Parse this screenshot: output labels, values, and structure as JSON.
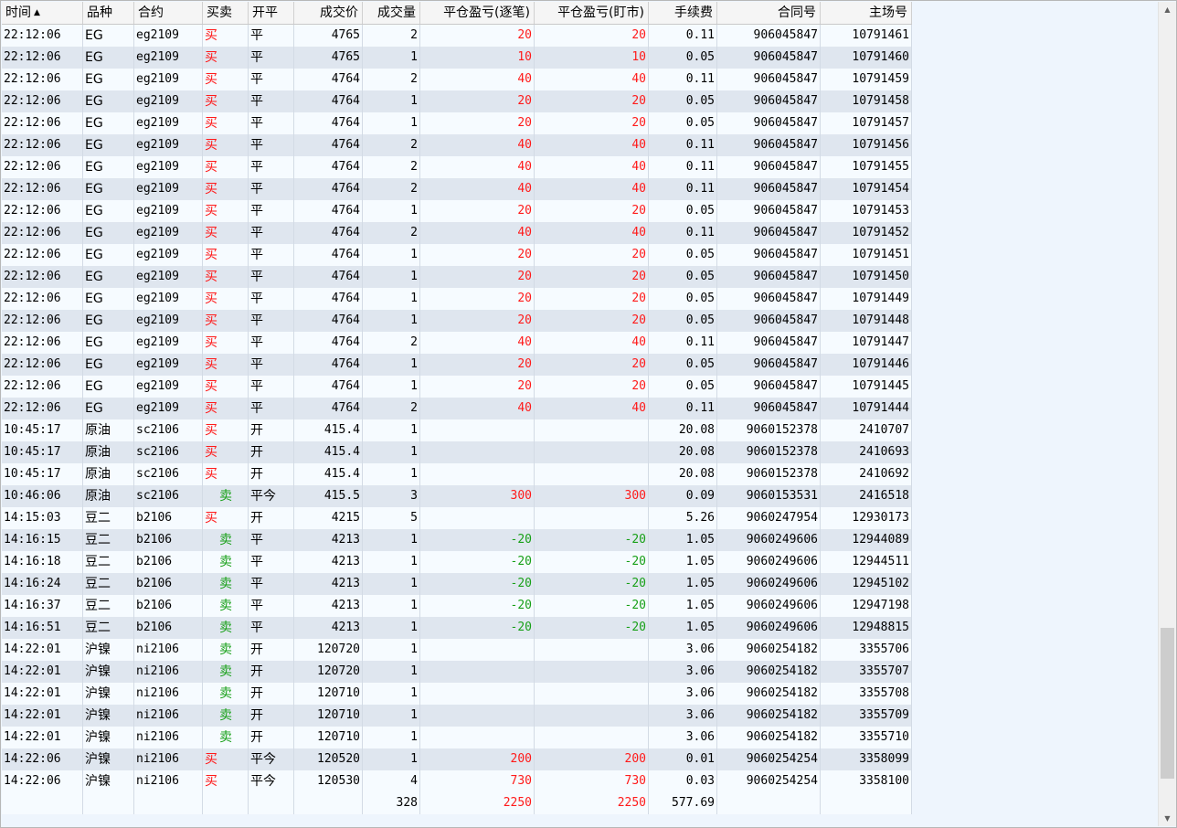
{
  "columns": [
    {
      "label": "时间",
      "w": 89,
      "align": "l"
    },
    {
      "label": "品种",
      "w": 56,
      "align": "l"
    },
    {
      "label": "合约",
      "w": 75,
      "align": "l"
    },
    {
      "label": "买卖",
      "w": 50,
      "align": "l"
    },
    {
      "label": "开平",
      "w": 50,
      "align": "l"
    },
    {
      "label": "成交价",
      "w": 75,
      "align": "r"
    },
    {
      "label": "成交量",
      "w": 63,
      "align": "r"
    },
    {
      "label": "平仓盈亏(逐笔)",
      "w": 125,
      "align": "r"
    },
    {
      "label": "平仓盈亏(盯市)",
      "w": 125,
      "align": "r"
    },
    {
      "label": "手续费",
      "w": 75,
      "align": "r"
    },
    {
      "label": "合同号",
      "w": 113,
      "align": "r"
    },
    {
      "label": "主场号",
      "w": 100,
      "align": "r"
    }
  ],
  "sort_indicator": "▲",
  "colors": {
    "buy": "#ff1a1a",
    "sell": "#18a018",
    "row_alt": "#dfe6ef"
  },
  "icons": {
    "scroll_up": "▲",
    "scroll_down": "▼"
  },
  "rows": [
    [
      "22:12:06",
      "EG",
      "eg2109",
      "买",
      "平",
      "4765",
      "2",
      "20",
      "20",
      "0.11",
      "906045847",
      "10791461"
    ],
    [
      "22:12:06",
      "EG",
      "eg2109",
      "买",
      "平",
      "4765",
      "1",
      "10",
      "10",
      "0.05",
      "906045847",
      "10791460"
    ],
    [
      "22:12:06",
      "EG",
      "eg2109",
      "买",
      "平",
      "4764",
      "2",
      "40",
      "40",
      "0.11",
      "906045847",
      "10791459"
    ],
    [
      "22:12:06",
      "EG",
      "eg2109",
      "买",
      "平",
      "4764",
      "1",
      "20",
      "20",
      "0.05",
      "906045847",
      "10791458"
    ],
    [
      "22:12:06",
      "EG",
      "eg2109",
      "买",
      "平",
      "4764",
      "1",
      "20",
      "20",
      "0.05",
      "906045847",
      "10791457"
    ],
    [
      "22:12:06",
      "EG",
      "eg2109",
      "买",
      "平",
      "4764",
      "2",
      "40",
      "40",
      "0.11",
      "906045847",
      "10791456"
    ],
    [
      "22:12:06",
      "EG",
      "eg2109",
      "买",
      "平",
      "4764",
      "2",
      "40",
      "40",
      "0.11",
      "906045847",
      "10791455"
    ],
    [
      "22:12:06",
      "EG",
      "eg2109",
      "买",
      "平",
      "4764",
      "2",
      "40",
      "40",
      "0.11",
      "906045847",
      "10791454"
    ],
    [
      "22:12:06",
      "EG",
      "eg2109",
      "买",
      "平",
      "4764",
      "1",
      "20",
      "20",
      "0.05",
      "906045847",
      "10791453"
    ],
    [
      "22:12:06",
      "EG",
      "eg2109",
      "买",
      "平",
      "4764",
      "2",
      "40",
      "40",
      "0.11",
      "906045847",
      "10791452"
    ],
    [
      "22:12:06",
      "EG",
      "eg2109",
      "买",
      "平",
      "4764",
      "1",
      "20",
      "20",
      "0.05",
      "906045847",
      "10791451"
    ],
    [
      "22:12:06",
      "EG",
      "eg2109",
      "买",
      "平",
      "4764",
      "1",
      "20",
      "20",
      "0.05",
      "906045847",
      "10791450"
    ],
    [
      "22:12:06",
      "EG",
      "eg2109",
      "买",
      "平",
      "4764",
      "1",
      "20",
      "20",
      "0.05",
      "906045847",
      "10791449"
    ],
    [
      "22:12:06",
      "EG",
      "eg2109",
      "买",
      "平",
      "4764",
      "1",
      "20",
      "20",
      "0.05",
      "906045847",
      "10791448"
    ],
    [
      "22:12:06",
      "EG",
      "eg2109",
      "买",
      "平",
      "4764",
      "2",
      "40",
      "40",
      "0.11",
      "906045847",
      "10791447"
    ],
    [
      "22:12:06",
      "EG",
      "eg2109",
      "买",
      "平",
      "4764",
      "1",
      "20",
      "20",
      "0.05",
      "906045847",
      "10791446"
    ],
    [
      "22:12:06",
      "EG",
      "eg2109",
      "买",
      "平",
      "4764",
      "1",
      "20",
      "20",
      "0.05",
      "906045847",
      "10791445"
    ],
    [
      "22:12:06",
      "EG",
      "eg2109",
      "买",
      "平",
      "4764",
      "2",
      "40",
      "40",
      "0.11",
      "906045847",
      "10791444"
    ],
    [
      "10:45:17",
      "原油",
      "sc2106",
      "买",
      "开",
      "415.4",
      "1",
      "",
      "",
      "20.08",
      "9060152378",
      "2410707"
    ],
    [
      "10:45:17",
      "原油",
      "sc2106",
      "买",
      "开",
      "415.4",
      "1",
      "",
      "",
      "20.08",
      "9060152378",
      "2410693"
    ],
    [
      "10:45:17",
      "原油",
      "sc2106",
      "买",
      "开",
      "415.4",
      "1",
      "",
      "",
      "20.08",
      "9060152378",
      "2410692"
    ],
    [
      "10:46:06",
      "原油",
      "sc2106",
      "卖",
      "平今",
      "415.5",
      "3",
      "300",
      "300",
      "0.09",
      "9060153531",
      "2416518"
    ],
    [
      "14:15:03",
      "豆二",
      "b2106",
      "买",
      "开",
      "4215",
      "5",
      "",
      "",
      "5.26",
      "9060247954",
      "12930173"
    ],
    [
      "14:16:15",
      "豆二",
      "b2106",
      "卖",
      "平",
      "4213",
      "1",
      "-20",
      "-20",
      "1.05",
      "9060249606",
      "12944089"
    ],
    [
      "14:16:18",
      "豆二",
      "b2106",
      "卖",
      "平",
      "4213",
      "1",
      "-20",
      "-20",
      "1.05",
      "9060249606",
      "12944511"
    ],
    [
      "14:16:24",
      "豆二",
      "b2106",
      "卖",
      "平",
      "4213",
      "1",
      "-20",
      "-20",
      "1.05",
      "9060249606",
      "12945102"
    ],
    [
      "14:16:37",
      "豆二",
      "b2106",
      "卖",
      "平",
      "4213",
      "1",
      "-20",
      "-20",
      "1.05",
      "9060249606",
      "12947198"
    ],
    [
      "14:16:51",
      "豆二",
      "b2106",
      "卖",
      "平",
      "4213",
      "1",
      "-20",
      "-20",
      "1.05",
      "9060249606",
      "12948815"
    ],
    [
      "14:22:01",
      "沪镍",
      "ni2106",
      "卖",
      "开",
      "120720",
      "1",
      "",
      "",
      "3.06",
      "9060254182",
      "3355706"
    ],
    [
      "14:22:01",
      "沪镍",
      "ni2106",
      "卖",
      "开",
      "120720",
      "1",
      "",
      "",
      "3.06",
      "9060254182",
      "3355707"
    ],
    [
      "14:22:01",
      "沪镍",
      "ni2106",
      "卖",
      "开",
      "120710",
      "1",
      "",
      "",
      "3.06",
      "9060254182",
      "3355708"
    ],
    [
      "14:22:01",
      "沪镍",
      "ni2106",
      "卖",
      "开",
      "120710",
      "1",
      "",
      "",
      "3.06",
      "9060254182",
      "3355709"
    ],
    [
      "14:22:01",
      "沪镍",
      "ni2106",
      "卖",
      "开",
      "120710",
      "1",
      "",
      "",
      "3.06",
      "9060254182",
      "3355710"
    ],
    [
      "14:22:06",
      "沪镍",
      "ni2106",
      "买",
      "平今",
      "120520",
      "1",
      "200",
      "200",
      "0.01",
      "9060254254",
      "3358099"
    ],
    [
      "14:22:06",
      "沪镍",
      "ni2106",
      "买",
      "平今",
      "120530",
      "4",
      "730",
      "730",
      "0.03",
      "9060254254",
      "3358100"
    ]
  ],
  "totals": [
    "",
    "",
    "",
    "",
    "",
    "",
    "328",
    "2250",
    "2250",
    "577.69",
    "",
    ""
  ],
  "scrollbar": {
    "thumb_start": 0.77,
    "thumb_end": 0.96
  }
}
